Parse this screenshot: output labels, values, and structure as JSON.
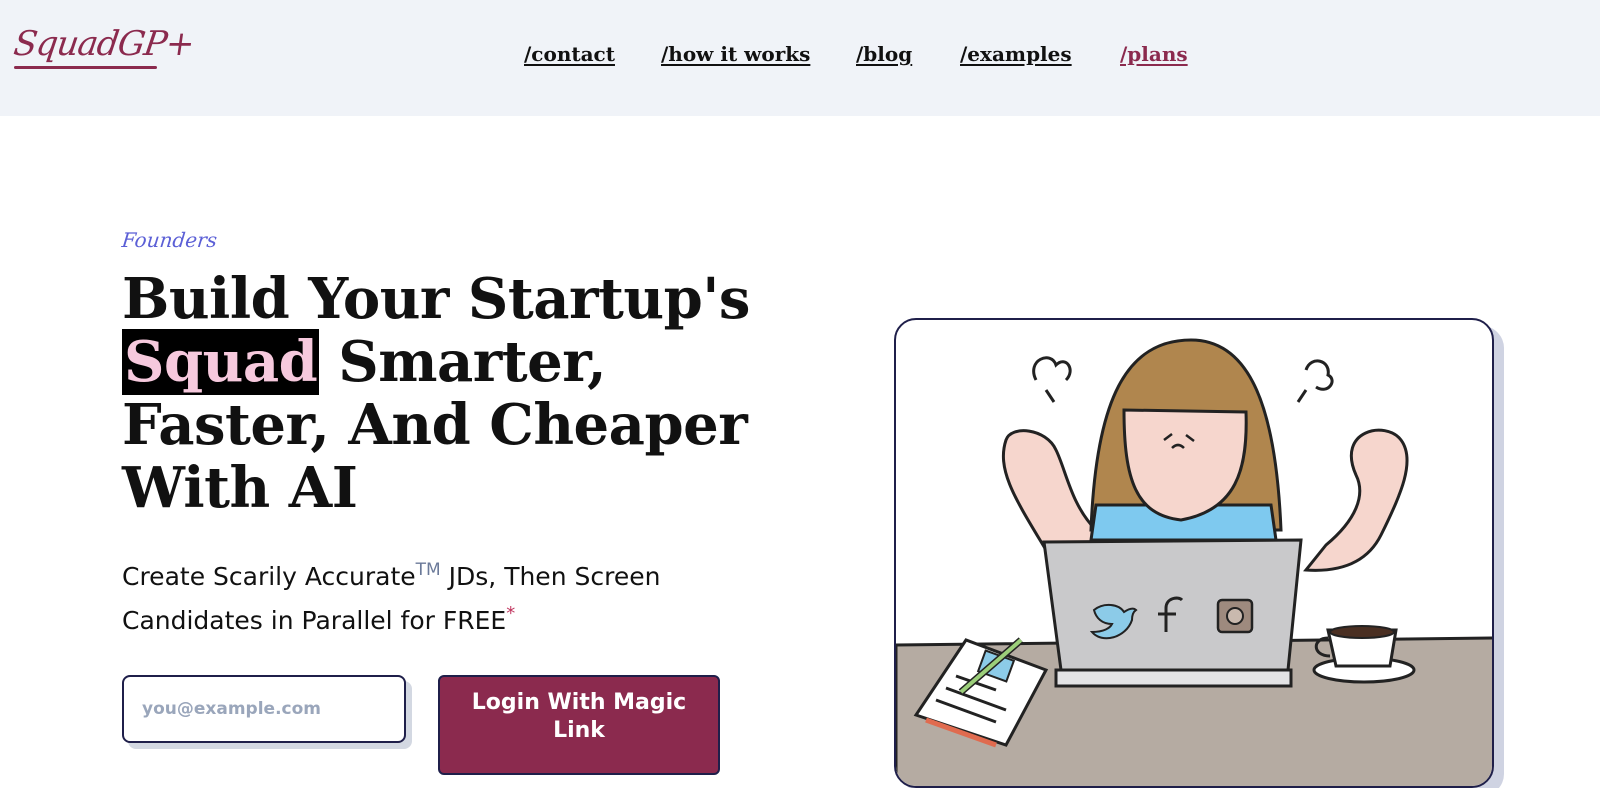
{
  "header": {
    "logo": "SquadGP+",
    "nav": [
      {
        "label": "/contact"
      },
      {
        "label": "/how it works"
      },
      {
        "label": "/blog"
      },
      {
        "label": "/examples"
      },
      {
        "label": "/plans",
        "active": true
      }
    ]
  },
  "hero": {
    "eyebrow": "Founders",
    "headline_line1": "Build Your Startup's",
    "headline_highlight": "Squad",
    "headline_line2_rest": " Smarter,",
    "headline_line3": "Faster, And Cheaper",
    "headline_line4": "With AI",
    "subhead_part1": "Create Scarily Accurate",
    "subhead_tm": "TM",
    "subhead_part2": " JDs, Then Screen Candidates in Parallel for FREE",
    "subhead_asterisk": "*",
    "email_placeholder": "you@example.com",
    "login_button": "Login With Magic Link"
  },
  "illustration": {
    "icon_names": [
      "twitter-icon",
      "facebook-icon",
      "instagram-icon"
    ]
  },
  "colors": {
    "brand": "#8b2a4e",
    "header_bg": "#f0f3f8",
    "highlight_text": "#f6c9dd",
    "eyebrow": "#5b5fd6"
  }
}
